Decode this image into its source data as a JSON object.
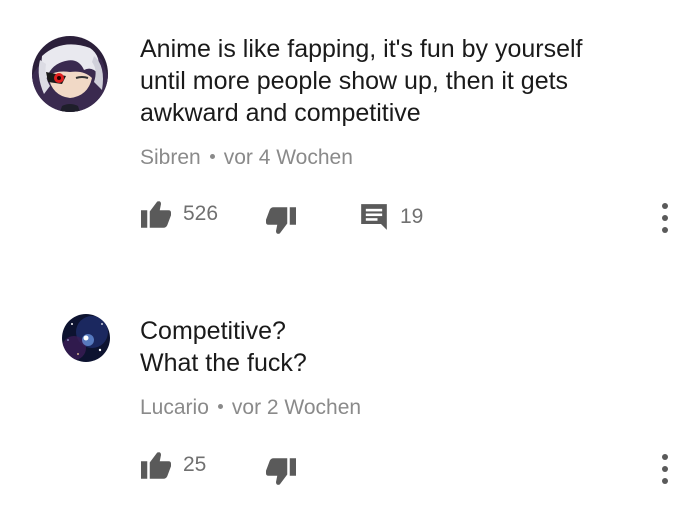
{
  "comments": [
    {
      "text_lines": [
        "Anime is like fapping, it's fun by yourself",
        "until more people show up, then it gets",
        "awkward and competitive"
      ],
      "author": "Sibren",
      "time": "vor 4 Wochen",
      "likes": "526",
      "replies": "19",
      "avatar_icon": "anime-character-avatar"
    },
    {
      "text_lines": [
        "Competitive?",
        "What the fuck?"
      ],
      "author": "Lucario",
      "time": "vor 2 Wochen",
      "likes": "25",
      "avatar_icon": "galaxy-avatar"
    }
  ],
  "icons": {
    "like": "thumb-up-icon",
    "dislike": "thumb-down-icon",
    "reply": "comment-icon",
    "more": "more-vertical-icon"
  },
  "colors": {
    "text": "#1a1a1a",
    "meta": "#8a8a8a",
    "icon": "#5a5a5a"
  }
}
